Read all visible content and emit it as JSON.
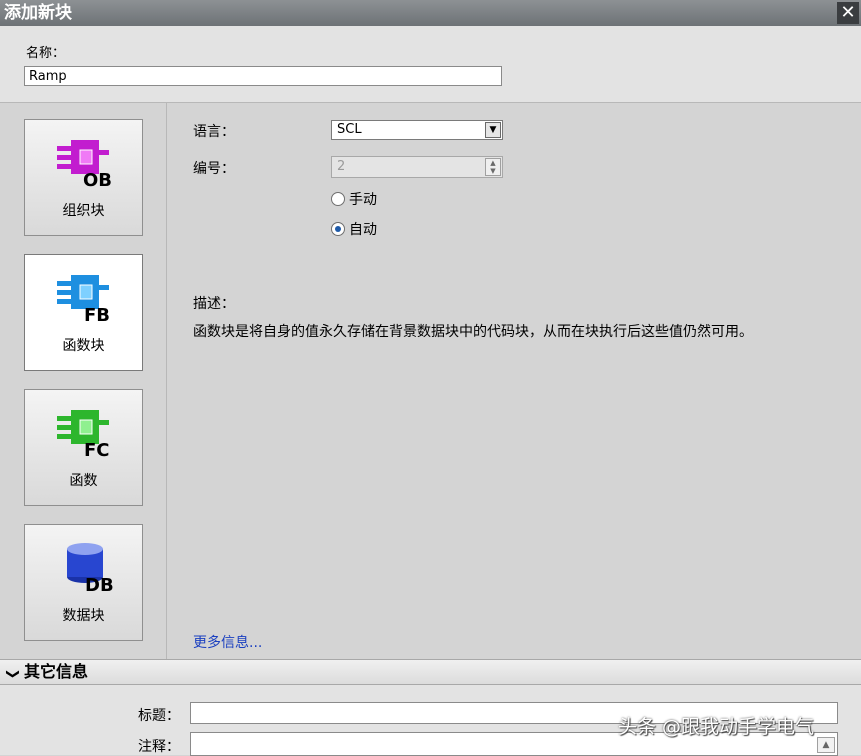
{
  "window": {
    "title": "添加新块",
    "close_label": "✕"
  },
  "name": {
    "label": "名称：",
    "value": "Ramp"
  },
  "sidebar": {
    "blocks": [
      {
        "code": "OB",
        "label": "组织块",
        "color": "#c21dcf",
        "selected": false
      },
      {
        "code": "FB",
        "label": "函数块",
        "color": "#1e8fe0",
        "selected": true
      },
      {
        "code": "FC",
        "label": "函数",
        "color": "#2db62d",
        "selected": false
      },
      {
        "code": "DB",
        "label": "数据块",
        "color": "#2846d0",
        "selected": false
      }
    ]
  },
  "main": {
    "language": {
      "label": "语言：",
      "value": "SCL"
    },
    "number": {
      "label": "编号：",
      "value": "2",
      "options": [
        {
          "label": "手动",
          "checked": false
        },
        {
          "label": "自动",
          "checked": true
        }
      ]
    },
    "description": {
      "label": "描述：",
      "text": "函数块是将自身的值永久存储在背景数据块中的代码块，从而在块执行后这些值仍然可用。"
    },
    "more_info": "更多信息..."
  },
  "other_info": {
    "header": "其它信息",
    "title_label": "标题：",
    "comment_label": "注释："
  },
  "watermark": "头条 @跟我动手学电气"
}
